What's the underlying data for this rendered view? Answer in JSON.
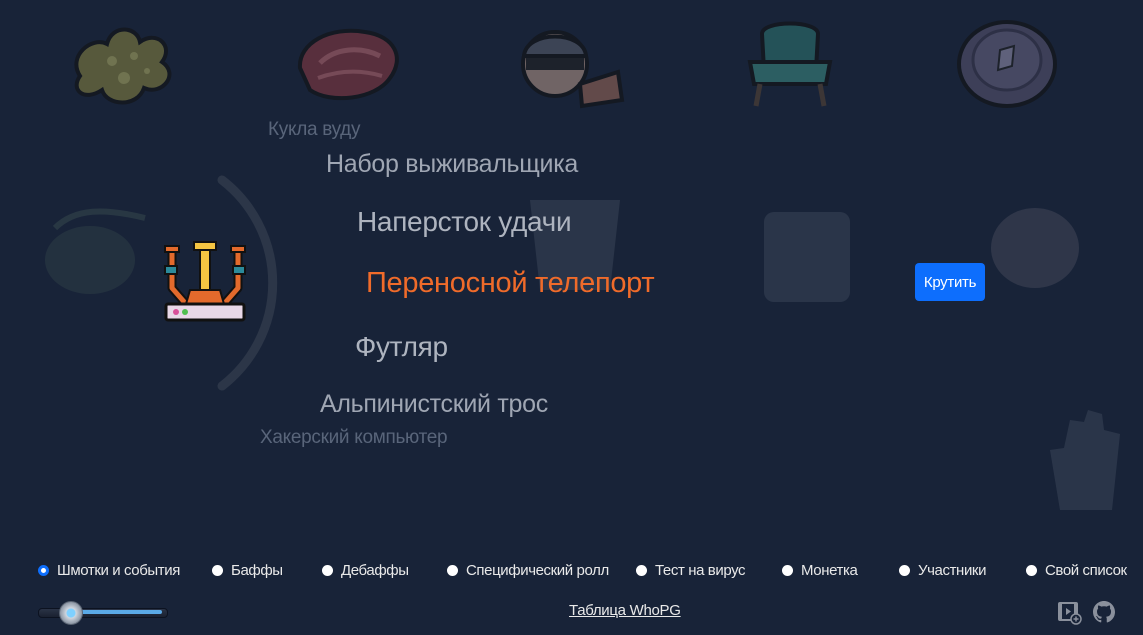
{
  "wheel": {
    "items": [
      "Кукла вуду",
      "Набор выживальщика",
      "Наперсток удачи",
      "Переносной телепорт",
      "Футляр",
      "Альпинистский трос",
      "Хакерский компьютер"
    ],
    "selected_index": 3,
    "selected_color": "#f06b2a",
    "current_icon": "portable-teleport-icon"
  },
  "spin_button": {
    "label": "Крутить",
    "color": "#0d6efd"
  },
  "modes": {
    "selected": 0,
    "items": [
      "Шмотки и события",
      "Баффы",
      "Дебаффы",
      "Специфический ролл",
      "Тест на вирус",
      "Монетка",
      "Участники",
      "Свой список"
    ]
  },
  "volume": {
    "level": 0.25
  },
  "footer": {
    "link_label": "Таблица WhoPG",
    "icons": [
      "video-add-icon",
      "github-icon"
    ]
  },
  "background_icons": [
    "slime-icon",
    "meat-icon",
    "robber-icon",
    "armchair-icon",
    "coin-icon",
    "cauldron-icon",
    "joker-icon",
    "vest-icon",
    "pig-icon",
    "hand-icon"
  ],
  "colors": {
    "background": "#182338",
    "accent": "#0d6efd"
  }
}
